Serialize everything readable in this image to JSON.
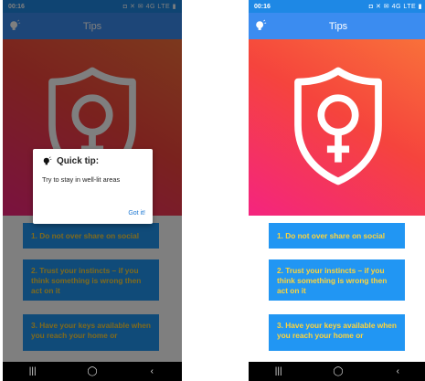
{
  "status": {
    "time": "00:16",
    "indicators": "◘ ✕ ✉ 4G LTE ▮"
  },
  "appbar": {
    "title": "Tips",
    "icon": "lightbulb-icon"
  },
  "tips": [
    "1. Do not over share on social",
    "2. Trust your instincts – if you think something is wrong then act on it",
    "3. Have your keys available when you reach your home or"
  ],
  "dialog": {
    "title": "Quick tip:",
    "message": "Try to stay in well-lit areas",
    "button": "Got it!"
  },
  "nav": {
    "recents": "|||",
    "home": "◯",
    "back": "‹"
  },
  "colors": {
    "appbar": "#3b8cf0",
    "card": "#2196f3",
    "card_text": "#ffd43a"
  }
}
